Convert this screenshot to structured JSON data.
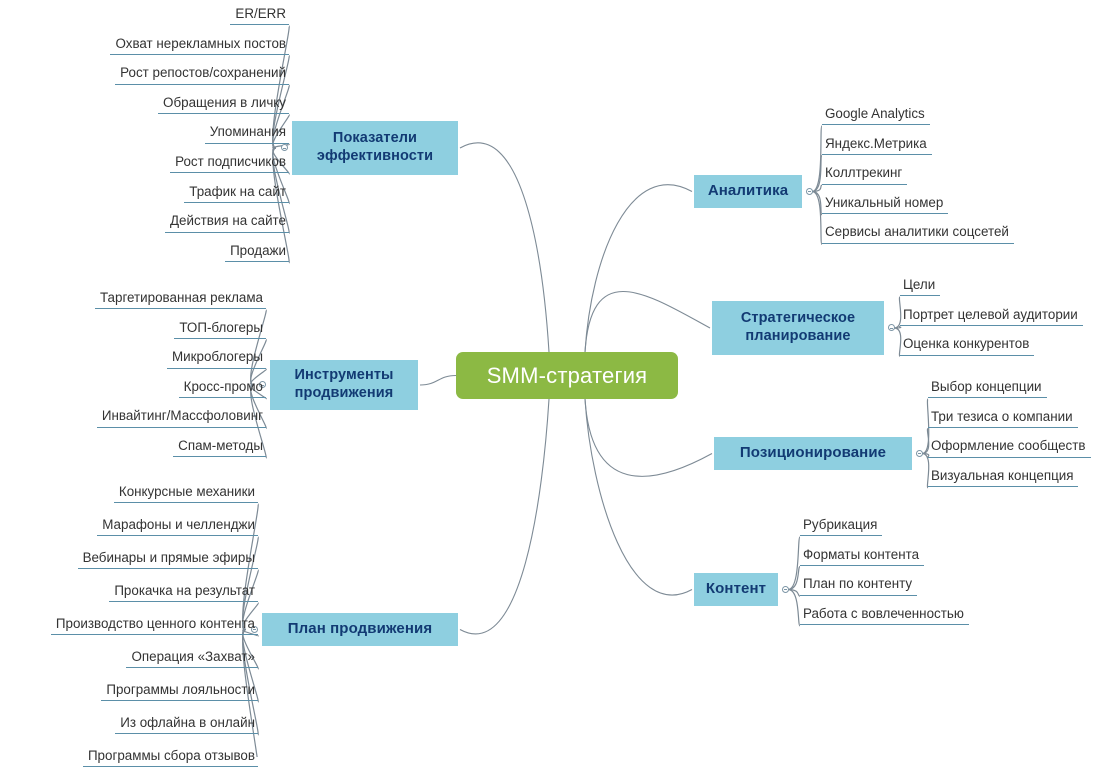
{
  "diagram": {
    "title": "SMM-стратегия",
    "colors": {
      "center_fill": "#8cb944",
      "center_text": "#ffffff",
      "branch_fill": "#8ecfe0",
      "branch_text": "#123a73",
      "leaf_text": "#333333",
      "leaf_underline": "#5b8fa8",
      "connector": "#7d8a95",
      "background": "#ffffff"
    },
    "center": {
      "label": "SMM-стратегия"
    },
    "branches": [
      {
        "id": "pokazateli",
        "label": "Показатели\nэффективности",
        "side": "left",
        "leaves": [
          "ER/ERR",
          "Охват нерекламных постов",
          "Рост репостов/сохранений",
          "Обращения в личку",
          "Упоминания",
          "Рост подписчиков",
          "Трафик на сайт",
          "Действия на сайте",
          "Продажи"
        ]
      },
      {
        "id": "instrumenty",
        "label": "Инструменты\nпродвижения",
        "side": "left",
        "leaves": [
          "Таргетированная реклама",
          "ТОП-блогеры",
          "Микроблогеры",
          "Кросс-промо",
          "Инвайтинг/Массфоловинг",
          "Спам-методы"
        ]
      },
      {
        "id": "plan",
        "label": "План продвижения",
        "side": "left",
        "leaves": [
          "Конкурсные механики",
          "Марафоны и челленджи",
          "Вебинары и прямые эфиры",
          "Прокачка на результат",
          "Производство ценного контента",
          "Операция «Захват»",
          "Программы лояльности",
          "Из офлайна в онлайн",
          "Программы сбора отзывов"
        ]
      },
      {
        "id": "analitika",
        "label": "Аналитика",
        "side": "right",
        "leaves": [
          "Google Analytics",
          "Яндекс.Метрика",
          "Коллтрекинг",
          "Уникальный номер",
          "Сервисы аналитики соцсетей"
        ]
      },
      {
        "id": "strategicheskoe",
        "label": "Стратегическое\nпланирование",
        "side": "right",
        "leaves": [
          "Цели",
          "Портрет целевой аудитории",
          "Оценка конкурентов"
        ]
      },
      {
        "id": "pozicionirovanie",
        "label": "Позиционирование",
        "side": "right",
        "leaves": [
          "Выбор концепции",
          "Три тезиса о компании",
          "Оформление сообществ",
          "Визуальная концепция"
        ]
      },
      {
        "id": "kontent",
        "label": "Контент",
        "side": "right",
        "leaves": [
          "Рубрикация",
          "Форматы контента",
          "План по контенту",
          "Работа с вовлеченностью"
        ]
      }
    ]
  }
}
